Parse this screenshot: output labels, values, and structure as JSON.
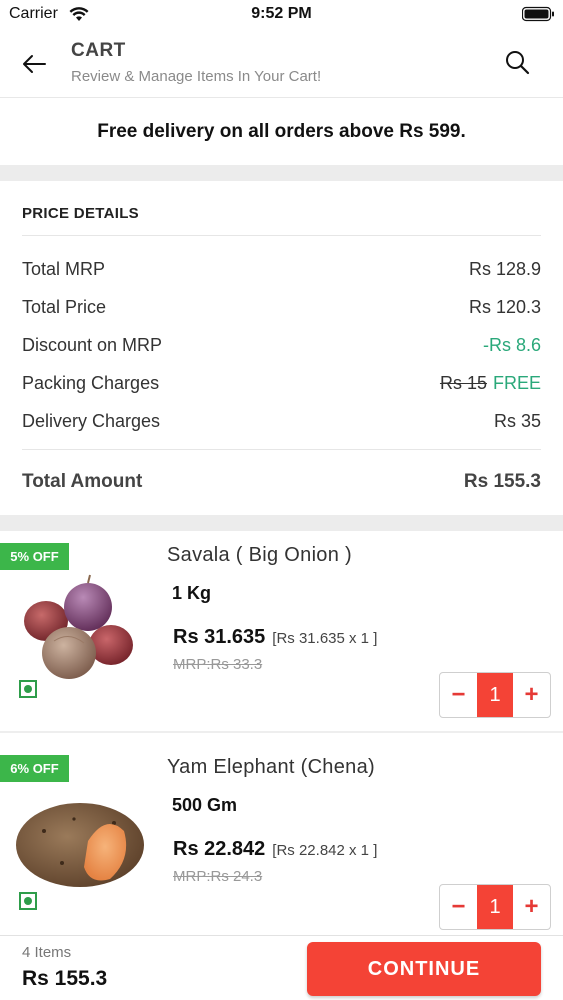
{
  "status_bar": {
    "carrier": "Carrier",
    "time": "9:52 PM",
    "icons": [
      "wifi-icon",
      "battery-icon"
    ]
  },
  "header": {
    "title": "CART",
    "subtitle": "Review & Manage Items In Your Cart!",
    "icons": [
      "back-arrow-icon",
      "search-icon"
    ]
  },
  "banner": {
    "text": "Free delivery on all orders above Rs 599."
  },
  "price_details": {
    "heading": "PRICE DETAILS",
    "rows": [
      {
        "label": "Total MRP",
        "value": "Rs 128.9"
      },
      {
        "label": "Total Price",
        "value": "Rs 120.3"
      },
      {
        "label": "Discount on MRP",
        "value": "-Rs 8.6"
      },
      {
        "label": "Packing Charges",
        "value_struck": "Rs 15",
        "value": "FREE"
      },
      {
        "label": "Delivery Charges",
        "value": "Rs 35"
      }
    ],
    "total_label": "Total Amount",
    "total_value": "Rs 155.3"
  },
  "products": [
    {
      "badge": "5% OFF",
      "name": "Savala ( Big Onion )",
      "quantity": "1 Kg",
      "price": "Rs 31.635",
      "calc": "[Rs 31.635 x 1 ]",
      "mrp": "MRP:Rs 33.3",
      "count": "1",
      "image": "onion-image"
    },
    {
      "badge": "6% OFF",
      "name": "Yam Elephant (Chena)",
      "quantity": "500 Gm",
      "price": "Rs 22.842",
      "calc": "[Rs 22.842 x 1 ]",
      "mrp": "MRP:Rs 24.3",
      "count": "1",
      "image": "yam-image"
    }
  ],
  "stepper": {
    "minus": "−",
    "plus": "+"
  },
  "footer": {
    "items": "4 Items",
    "total": "Rs 155.3",
    "button": "CONTINUE"
  },
  "colors": {
    "accent": "#f44336",
    "badge_green": "#3cb64a",
    "discount_green": "#2aa87a",
    "veg_green": "#2e9d4a"
  }
}
